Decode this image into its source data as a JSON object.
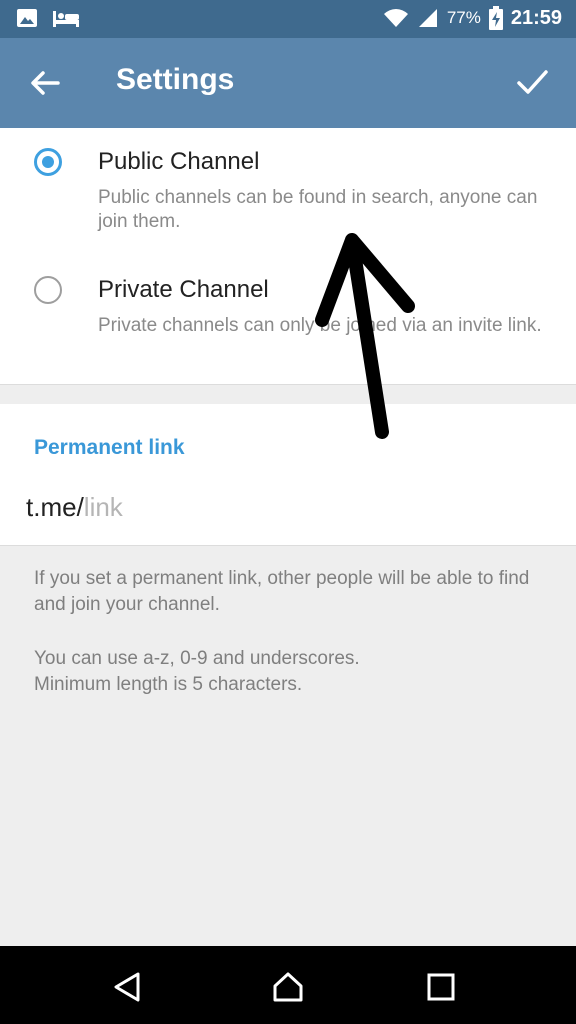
{
  "status_bar": {
    "battery_percent": "77%",
    "time": "21:59",
    "icons": [
      "image-icon",
      "bed-icon",
      "wifi-icon",
      "signal-icon",
      "battery-charging-icon"
    ]
  },
  "app_bar": {
    "title": "Settings",
    "back_icon": "arrow-left-icon",
    "done_icon": "check-icon"
  },
  "channel_type": {
    "options": [
      {
        "title": "Public Channel",
        "description": "Public channels can be found in search, anyone can join them.",
        "selected": true
      },
      {
        "title": "Private Channel",
        "description": "Private channels can only be joined via an invite link.",
        "selected": false
      }
    ]
  },
  "permanent_link": {
    "header": "Permanent link",
    "prefix": "t.me/",
    "placeholder": "link",
    "value": ""
  },
  "info": {
    "paragraph1": "If you set a permanent link, other people will be able to find and join your channel.",
    "paragraph2_line1": "You can use a-z, 0-9 and underscores.",
    "paragraph2_line2": "Minimum length is 5 characters."
  },
  "nav_bar": {
    "icons": [
      "back-triangle-icon",
      "home-icon",
      "recents-icon"
    ]
  },
  "colors": {
    "status_bar": "#3f6a8e",
    "app_bar": "#5b86ad",
    "accent": "#3ea0e0",
    "link_header": "#3a98d8"
  }
}
